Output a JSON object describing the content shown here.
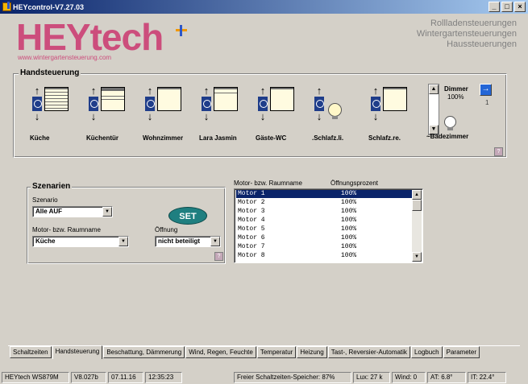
{
  "window": {
    "title": "HEYcontrol-V7.27.03"
  },
  "header": {
    "logo": "HEYtech",
    "logo_sub": "www.wintergartensteuerung.com",
    "taglines": [
      "Rollladensteuerungen",
      "Wintergartensteuerungen",
      "Haussteuerungen"
    ]
  },
  "handsteuerung": {
    "title": "Handsteuerung",
    "items": [
      {
        "label": "Küche"
      },
      {
        "label": "Küchentür"
      },
      {
        "label": "Wohnzimmer"
      },
      {
        "label": "Lara Jasmin"
      },
      {
        "label": "Gäste-WC"
      },
      {
        "label": ".Schlafz.li."
      },
      {
        "label": "Schlafz.re."
      },
      {
        "label": "~Badezimmer"
      }
    ],
    "dimmer_label": "Dimmer",
    "dimmer_value": "100%",
    "page_number": "1"
  },
  "szenarien": {
    "title": "Szenarien",
    "scenario_label": "Szenario",
    "scenario_value": "Alle AUF",
    "motor_label": "Motor- bzw. Raumname",
    "motor_value": "Küche",
    "opening_label": "Öffnung",
    "opening_value": "nicht beteiligt",
    "set_label": "SET"
  },
  "motor_list": {
    "col1": "Motor- bzw. Raumname",
    "col2": "Öffnungsprozent",
    "rows": [
      {
        "name": "Motor 1",
        "value": "100%"
      },
      {
        "name": "Motor 2",
        "value": "100%"
      },
      {
        "name": "Motor 3",
        "value": "100%"
      },
      {
        "name": "Motor 4",
        "value": "100%"
      },
      {
        "name": "Motor 5",
        "value": "100%"
      },
      {
        "name": "Motor 6",
        "value": "100%"
      },
      {
        "name": "Motor 7",
        "value": "100%"
      },
      {
        "name": "Motor 8",
        "value": "100%"
      }
    ]
  },
  "tabs": [
    "Schaltzeiten",
    "Handsteuerung",
    "Beschattung, Dämmerung",
    "Wind, Regen, Feuchte",
    "Temperatur",
    "Heizung",
    "Tast-, Reversier-Automatik",
    "Logbuch",
    "Parameter"
  ],
  "status": {
    "device": "HEYtech WS879M",
    "version": "V8.027b",
    "date": "07.11.16",
    "time": "12:35:23",
    "memory": "Freier Schaltzeiten-Speicher: 87%",
    "lux": "Lux:  27 k",
    "wind": "Wind: 0",
    "at": "AT: 6.8°",
    "it": "IT: 22.4°"
  },
  "colors": {
    "logo": "#cc4d7c",
    "accent": "#0a246a",
    "set_button": "#1f7f80"
  }
}
